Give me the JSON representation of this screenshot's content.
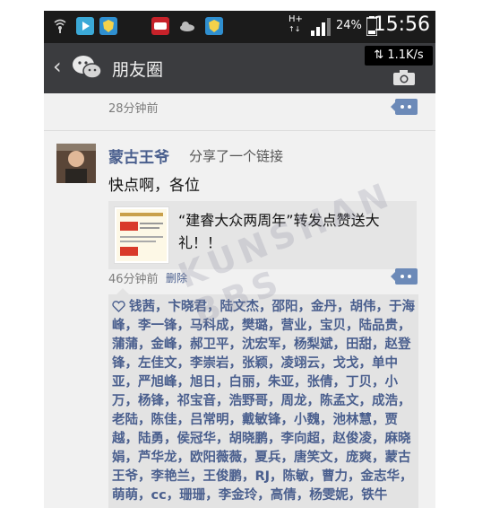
{
  "statusbar": {
    "network": "H+",
    "battery": "24%",
    "time": "15:56",
    "speed": "1.1K/s"
  },
  "titlebar": {
    "title": "朋友圈"
  },
  "feed": {
    "prev_time": "28分钟前",
    "post": {
      "author": "蒙古王爷",
      "action": "分享了一个链接",
      "text": "快点啊，各位",
      "link_title": "“建睿大众两周年”转发点赞送大礼！！",
      "time": "46分钟前",
      "delete_label": "删除",
      "likes": "钱茜，卞晓君，陆文杰，邵阳，金丹，胡伟，于海峰，李一锋，马科成，樊璐，营业，宝贝，陆品贵，蒲蒲，金峰，郝卫平，沈宏军，杨梨斌，田甜，赵登锋，左佳文，李崇岩，张颖，凌翊云，戈戈，单中亚，严旭峰，旭日，白丽，朱亚，张倩，丁贝，小万，杨锋，祁宝音，浩野哥，周龙，陈孟文，成浩，老陆，陈佳，吕常明，戴敏锋，小魏，池林慧，贾越，陆勇，侯冠华，胡晓鹏，李向超，赵俊凌，麻晓娟，芦华龙，欧阳薇薇，夏兵，唐笑文，庞爽，蒙古王爷，李艳兰，王俊鹏，RJ，陈敏，曹力，金志华，萌萌，cc，珊珊，李金玲，高倩，杨雯妮，铁牛"
    }
  },
  "colors": {
    "accent_link": "#4a5f8e",
    "titlebar_bg": "#3b3c3f",
    "wechat_green": "#43b649"
  }
}
